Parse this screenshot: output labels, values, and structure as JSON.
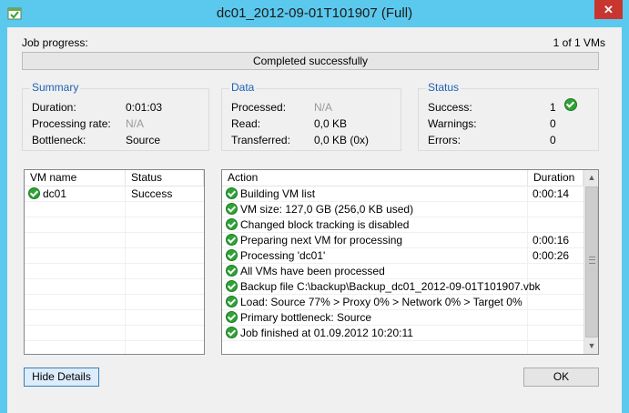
{
  "window": {
    "title": "dc01_2012-09-01T101907 (Full)",
    "close_glyph": "✕",
    "icon": "veeam-job-icon"
  },
  "job": {
    "progress_label": "Job progress:",
    "vm_count": "1 of 1 VMs",
    "progress_text": "Completed successfully",
    "progress_fraction": 1.0
  },
  "summary": {
    "title": "Summary",
    "duration_label": "Duration:",
    "duration_value": "0:01:03",
    "rate_label": "Processing rate:",
    "rate_value": "N/A",
    "bottleneck_label": "Bottleneck:",
    "bottleneck_value": "Source"
  },
  "data": {
    "title": "Data",
    "processed_label": "Processed:",
    "processed_value": "N/A",
    "read_label": "Read:",
    "read_value": "0,0 KB",
    "transferred_label": "Transferred:",
    "transferred_value": "0,0 KB (0x)"
  },
  "status": {
    "title": "Status",
    "success_label": "Success:",
    "success_value": "1",
    "warnings_label": "Warnings:",
    "warnings_value": "0",
    "errors_label": "Errors:",
    "errors_value": "0"
  },
  "vm_table": {
    "col_name": "VM name",
    "col_status": "Status",
    "rows": [
      {
        "name": "dc01",
        "status": "Success"
      }
    ]
  },
  "action_table": {
    "col_action": "Action",
    "col_duration": "Duration",
    "rows": [
      {
        "action": "Building VM list",
        "duration": "0:00:14"
      },
      {
        "action": "VM size: 127,0 GB (256,0 KB used)",
        "duration": ""
      },
      {
        "action": "Changed block tracking is disabled",
        "duration": ""
      },
      {
        "action": "Preparing next VM for processing",
        "duration": "0:00:16"
      },
      {
        "action": "Processing 'dc01'",
        "duration": "0:00:26"
      },
      {
        "action": "All VMs have been processed",
        "duration": ""
      },
      {
        "action": "Backup file C:\\backup\\Backup_dc01_2012-09-01T101907.vbk",
        "duration": ""
      },
      {
        "action": "Load: Source 77% > Proxy 0% > Network 0% > Target 0%",
        "duration": ""
      },
      {
        "action": "Primary bottleneck: Source",
        "duration": ""
      },
      {
        "action": "Job finished at 01.09.2012 10:20:11",
        "duration": ""
      }
    ]
  },
  "buttons": {
    "hide_details": "Hide Details",
    "ok": "OK"
  },
  "colors": {
    "window_frame": "#5bc8ed",
    "group_title": "#1e62b4",
    "success_green": "#2fa336",
    "close_red": "#c7372f"
  }
}
